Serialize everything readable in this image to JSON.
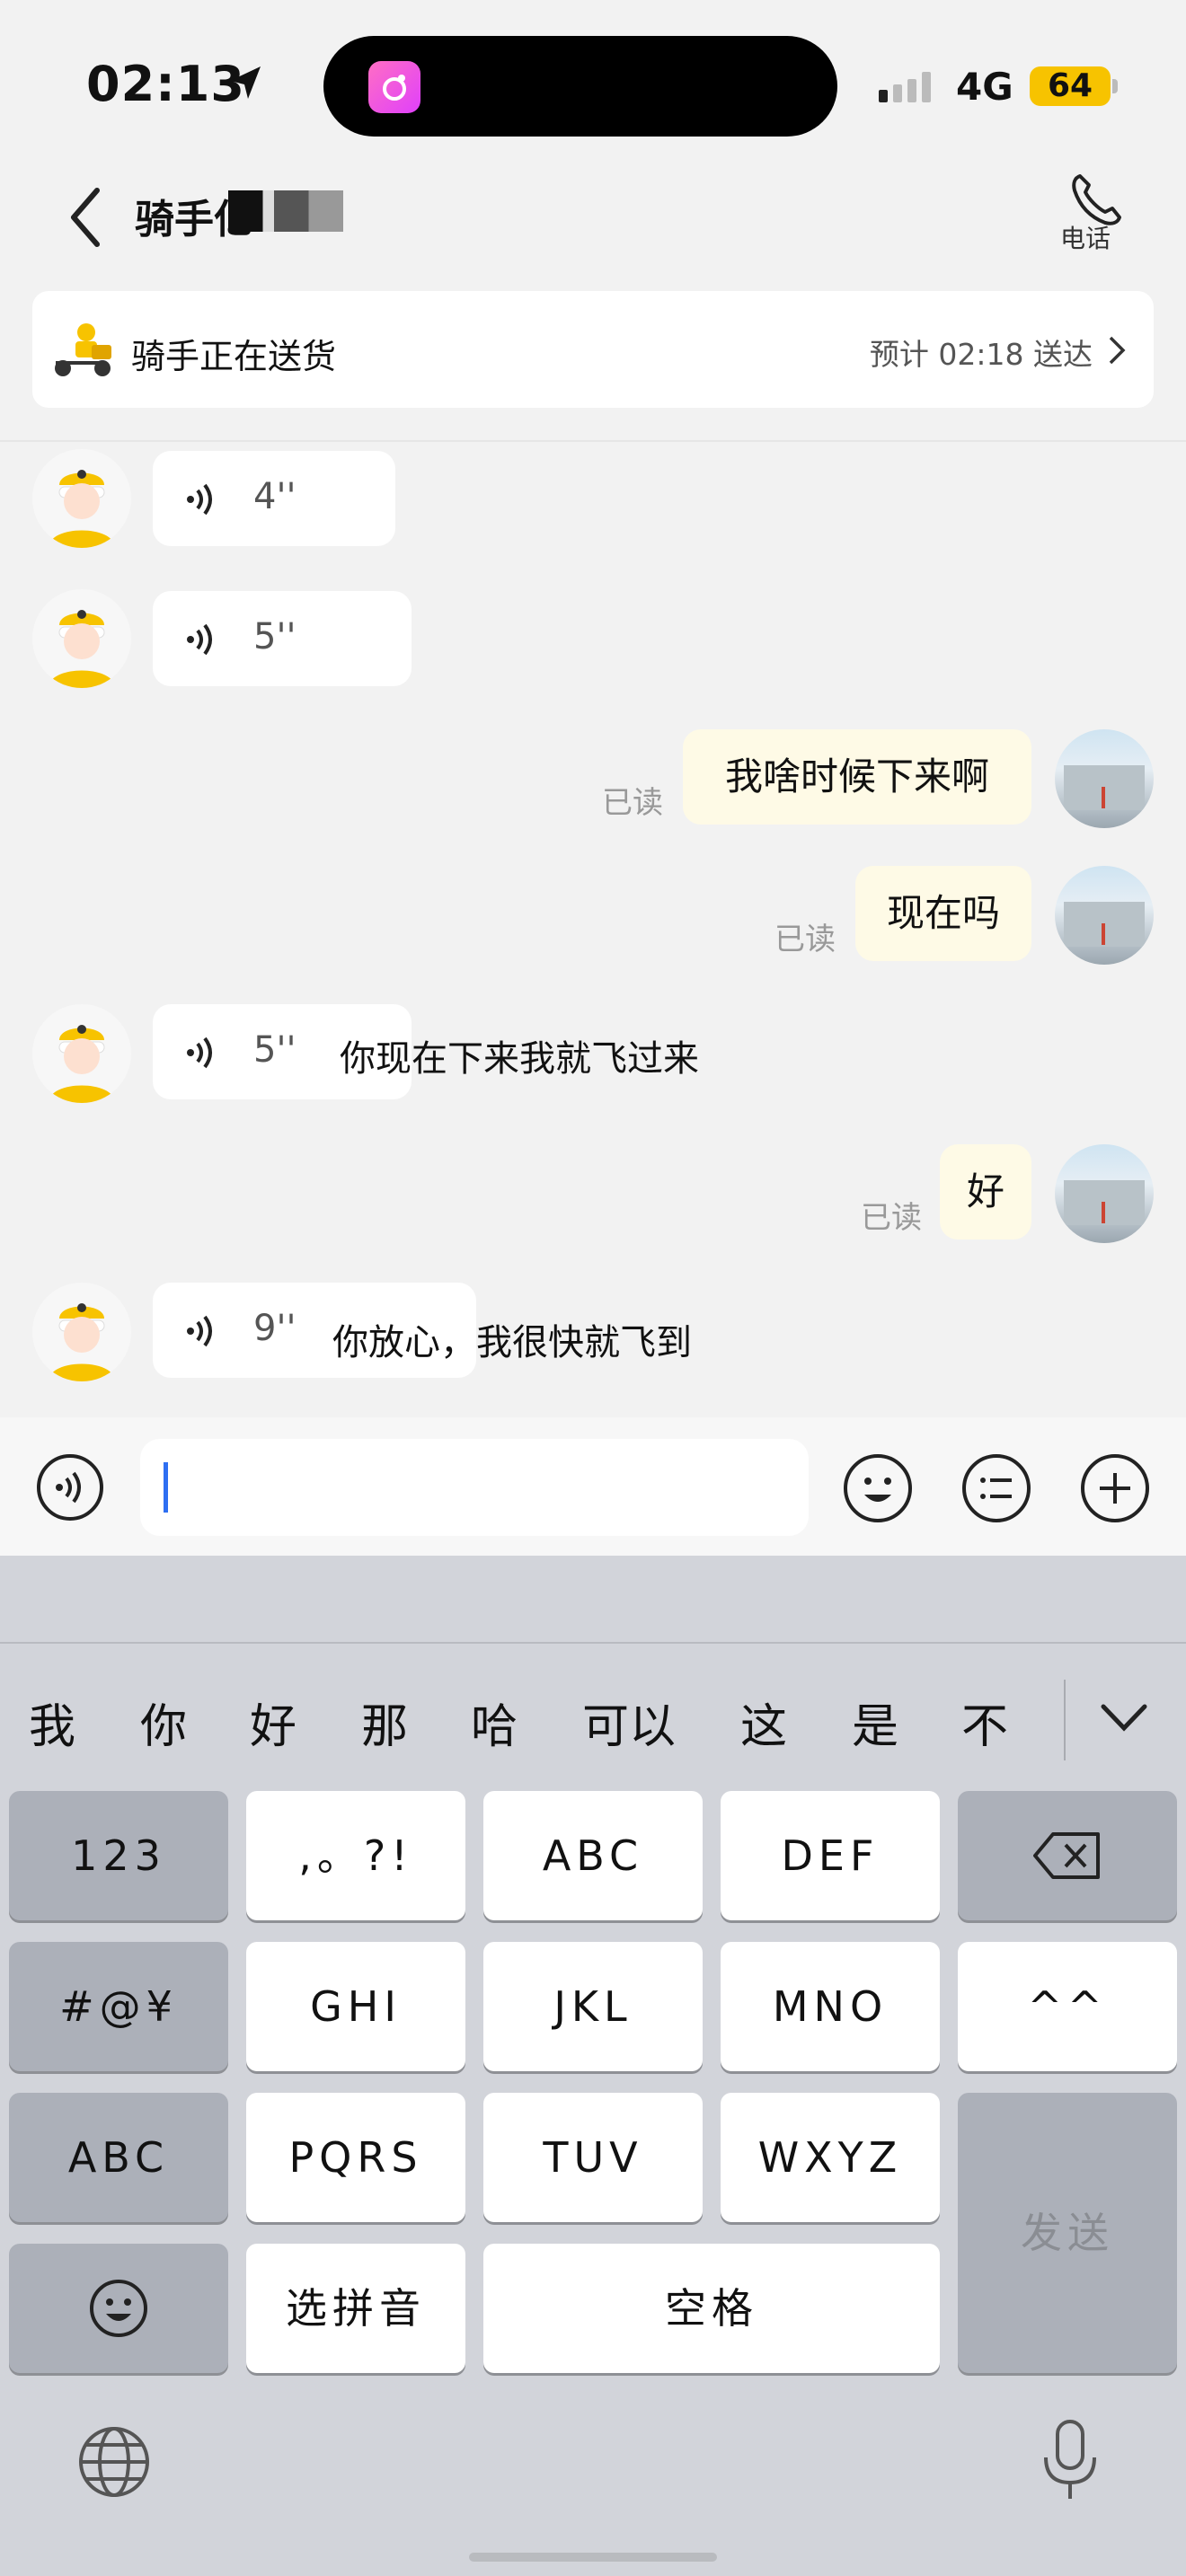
{
  "status_bar": {
    "time": "02:13",
    "network": "4G",
    "battery": "64"
  },
  "header": {
    "title": "骑手亿",
    "call_label": "电话"
  },
  "delivery_card": {
    "status": "骑手正在送货",
    "eta": "预计 02:18 送达"
  },
  "messages": [
    {
      "from": "rider",
      "type": "voice",
      "duration": "4''"
    },
    {
      "from": "rider",
      "type": "voice",
      "duration": "5''"
    },
    {
      "from": "user",
      "type": "text",
      "text": "我啥时候下来啊",
      "status": "已读"
    },
    {
      "from": "user",
      "type": "text",
      "text": "现在吗",
      "status": "已读"
    },
    {
      "from": "rider",
      "type": "voice",
      "duration": "5''",
      "transcript": "你现在下来我就飞过来"
    },
    {
      "from": "user",
      "type": "text",
      "text": "好",
      "status": "已读"
    },
    {
      "from": "rider",
      "type": "voice",
      "duration": "9''",
      "transcript": "你放心，我很快就飞到"
    }
  ],
  "input_bar": {
    "text": ""
  },
  "keyboard": {
    "candidates": [
      "我",
      "你",
      "好",
      "那",
      "哈",
      "可以",
      "这",
      "是",
      "不"
    ],
    "rows": [
      [
        "123",
        ",。?!",
        "ABC",
        "DEF"
      ],
      [
        "#@¥",
        "GHI",
        "JKL",
        "MNO",
        "^^"
      ],
      [
        "ABC",
        "PQRS",
        "TUV",
        "WXYZ"
      ],
      [
        "选拼音",
        "空格"
      ]
    ],
    "send_label": "发送"
  },
  "colors": {
    "accent": "#2e6ff2",
    "battery": "#f7c300",
    "user_bubble": "#fefae6"
  },
  "icons": [
    "location-arrow-icon",
    "app-icon",
    "signal-icon",
    "back-chevron-icon",
    "phone-icon",
    "scooter-icon",
    "chevron-right-icon",
    "voice-wave-icon",
    "voice-input-icon",
    "emoji-icon",
    "list-icon",
    "plus-icon",
    "backspace-icon",
    "smiley-key-icon",
    "globe-icon",
    "microphone-icon"
  ]
}
